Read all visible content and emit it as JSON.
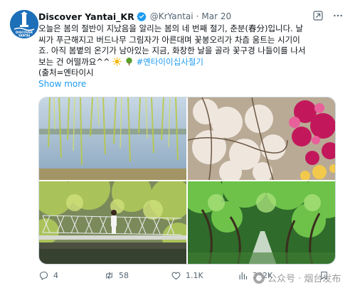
{
  "tweet": {
    "display_name": "Discover Yantai_KR",
    "handle": "@KrYantai",
    "time": "Mar 20",
    "lines": [
      "오늘은 봄의 절반이 지났음을 알리는 봄의 네 번째 절기, 춘분(春分)입니다. 날",
      "씨가 푸근해지고 버드나무 그림자가 아른대며 꽃봉오리가 차츰 움트는 시기이",
      "죠. 아직 봄볕의 온기가 남아있는 지금, 화창한 날을 골라 꽃구경 나들이를 나서",
      "보는 건 어떨까요^^"
    ],
    "hashtag": "#옌타이이십사절기",
    "source_line": "(출처=옌타이시",
    "show_more": "Show more",
    "avatar_text": "DISCOVER YANTAI"
  },
  "actions": {
    "replies": "4",
    "retweets": "58",
    "likes": "1.1K",
    "views": "332K"
  },
  "watermark": {
    "text": "公众号 · 烟台发布"
  },
  "photos": [
    {
      "subject": "willow-over-lake"
    },
    {
      "subject": "white-and-pink-blossoms"
    },
    {
      "subject": "suspension-bridge-woman"
    },
    {
      "subject": "green-tree-avenue"
    }
  ],
  "colors": {
    "accent": "#1d9bf0",
    "text": "#0f1419",
    "muted": "#536471",
    "avatar_bg": "#1d6fb8"
  }
}
